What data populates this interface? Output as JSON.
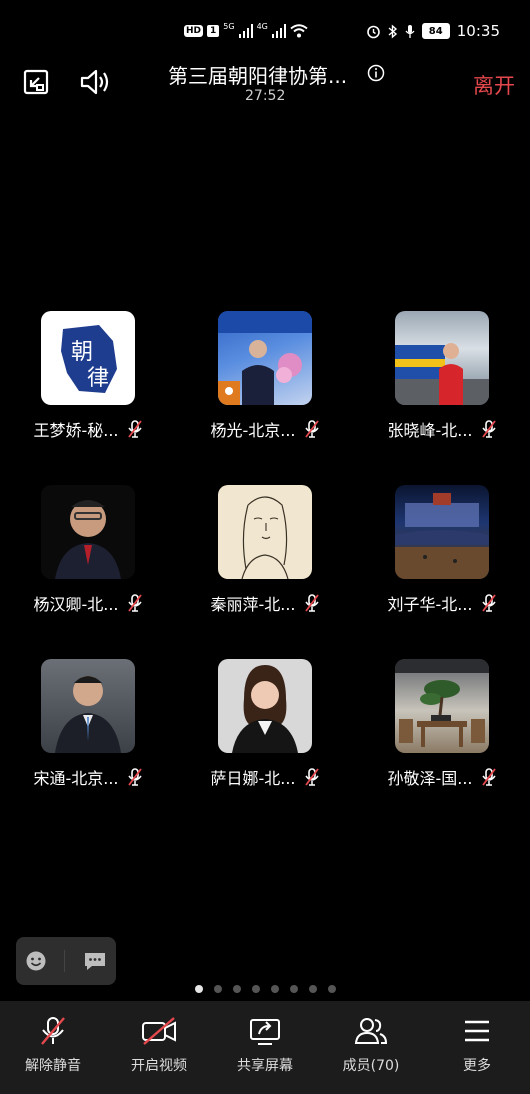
{
  "status_bar": {
    "hd_label": "HD",
    "sim_badge": "1",
    "network_5g": "5G",
    "network_4g": "4G",
    "battery": "84",
    "time": "10:35"
  },
  "meeting": {
    "title": "第三届朝阳律协第...",
    "elapsed": "27:52",
    "leave_label": "离开"
  },
  "participants": [
    {
      "name": "王梦娇-秘...",
      "muted": true,
      "avatar": "logo-avatar"
    },
    {
      "name": "杨光-北京...",
      "muted": true,
      "avatar": "stage-photo-avatar"
    },
    {
      "name": "张晓峰-北...",
      "muted": true,
      "avatar": "train-station-photo-avatar"
    },
    {
      "name": "杨汉卿-北...",
      "muted": true,
      "avatar": "portrait-photo-avatar"
    },
    {
      "name": "秦丽萍-北...",
      "muted": true,
      "avatar": "sketch-avatar"
    },
    {
      "name": "刘子华-北...",
      "muted": true,
      "avatar": "night-palace-photo-avatar"
    },
    {
      "name": "宋通-北京...",
      "muted": true,
      "avatar": "suit-portrait-avatar"
    },
    {
      "name": "萨日娜-北...",
      "muted": true,
      "avatar": "woman-portrait-avatar"
    },
    {
      "name": "孙敬泽-国...",
      "muted": true,
      "avatar": "bonsai-room-photo-avatar"
    }
  ],
  "pagination": {
    "total": 8,
    "current": 1
  },
  "toolbar": {
    "unmute": "解除静音",
    "start_video": "开启视频",
    "share_screen": "共享屏幕",
    "members": "成员(70)",
    "more": "更多"
  },
  "colors": {
    "leave": "#e5484d",
    "background": "#000000",
    "toolbar": "#1c1c1c"
  }
}
